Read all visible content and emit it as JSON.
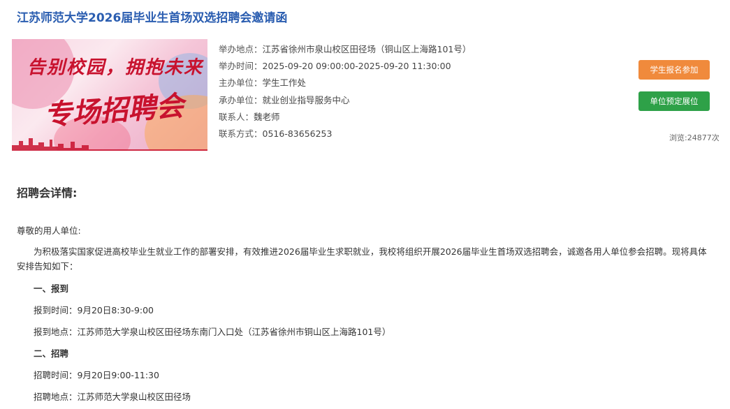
{
  "page": {
    "title": "江苏师范大学2026届毕业生首场双选招聘会邀请函"
  },
  "banner": {
    "slogan": "告别校园，拥抱未来",
    "headline": "专场招聘会"
  },
  "info": {
    "location": {
      "label": "举办地点：",
      "value": "江苏省徐州市泉山校区田径场（铜山区上海路101号）"
    },
    "time": {
      "label": "举办时间：",
      "value": "2025-09-20 09:00:00-2025-09-20 11:30:00"
    },
    "host": {
      "label": "主办单位：",
      "value": "学生工作处"
    },
    "organizer": {
      "label": "承办单位：",
      "value": "就业创业指导服务中心"
    },
    "contact": {
      "label": "联系人：",
      "value": "魏老师"
    },
    "phone": {
      "label": "联系方式：",
      "value": "0516-83656253"
    }
  },
  "actions": {
    "student_signup": "学生报名参加",
    "booth_booking": "单位预定展位"
  },
  "stats": {
    "views": "浏览:24877次"
  },
  "details": {
    "heading": "招聘会详情:",
    "salutation": "尊敬的用人单位:",
    "intro": "为积极落实国家促进高校毕业生就业工作的部署安排，有效推进2026届毕业生求职就业，我校将组织开展2026届毕业生首场双选招聘会，诚邀各用人单位参会招聘。现将具体安排告知如下：",
    "section1": {
      "title": "一、报到",
      "time": "报到时间：9月20日8:30-9:00",
      "place": "报到地点：江苏师范大学泉山校区田径场东南门入口处（江苏省徐州市铜山区上海路101号）"
    },
    "section2": {
      "title": "二、招聘",
      "time": "招聘时间：9月20日9:00-11:30",
      "place": "招聘地点：江苏师范大学泉山校区田径场"
    }
  },
  "colors": {
    "title": "#2a5db0",
    "signup_button": "#f08a3c",
    "booking_button": "#2ea148"
  }
}
